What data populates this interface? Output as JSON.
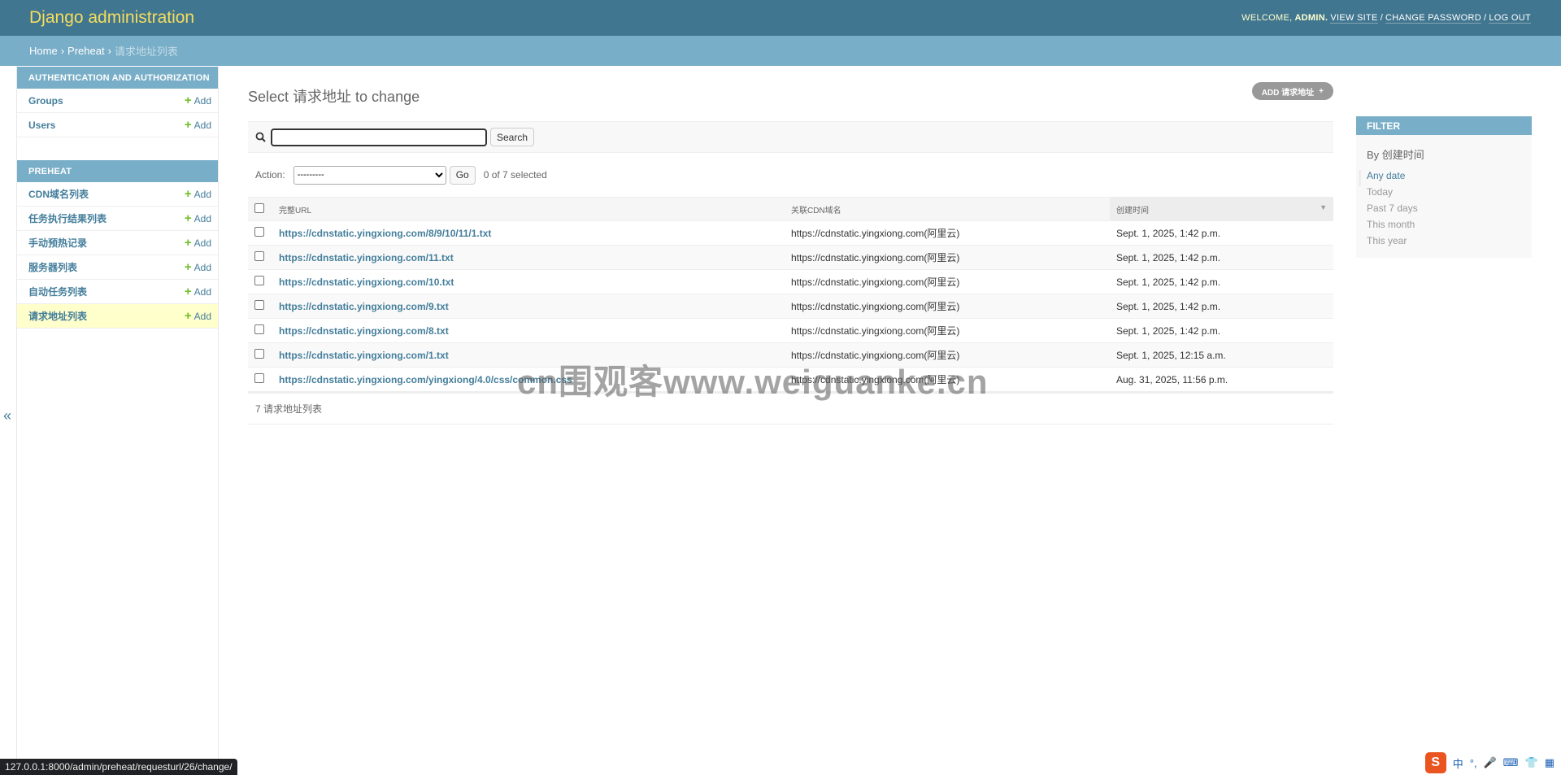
{
  "header": {
    "site_name": "Django administration",
    "welcome": "WELCOME,",
    "username": "ADMIN.",
    "view_site": "VIEW SITE",
    "change_password": "CHANGE PASSWORD",
    "logout": "LOG OUT",
    "sep": "/"
  },
  "breadcrumbs": {
    "home": "Home",
    "app": "Preheat",
    "current": "请求地址列表",
    "sep": "›"
  },
  "sidebar": {
    "toggle": "«",
    "modules": [
      {
        "caption": "AUTHENTICATION AND AUTHORIZATION",
        "items": [
          {
            "label": "Groups",
            "add": "Add"
          },
          {
            "label": "Users",
            "add": "Add"
          }
        ]
      },
      {
        "caption": "PREHEAT",
        "items": [
          {
            "label": "CDN域名列表",
            "add": "Add"
          },
          {
            "label": "任务执行结果列表",
            "add": "Add"
          },
          {
            "label": "手动预热记录",
            "add": "Add"
          },
          {
            "label": "服务器列表",
            "add": "Add"
          },
          {
            "label": "自动任务列表",
            "add": "Add"
          },
          {
            "label": "请求地址列表",
            "add": "Add"
          }
        ]
      }
    ]
  },
  "content": {
    "title": "Select 请求地址 to change",
    "add_button": "ADD 请求地址",
    "search_button": "Search",
    "search_value": "",
    "action_label": "Action:",
    "action_selected": "---------",
    "go_button": "Go",
    "selected_count": "0 of 7 selected",
    "columns": [
      "完整URL",
      "关联CDN域名",
      "创建时间"
    ],
    "rows": [
      {
        "url": "https://cdnstatic.yingxiong.com/8/9/10/11/1.txt",
        "cdn": "https://cdnstatic.yingxiong.com(阿里云)",
        "created": "Sept. 1, 2025, 1:42 p.m."
      },
      {
        "url": "https://cdnstatic.yingxiong.com/11.txt",
        "cdn": "https://cdnstatic.yingxiong.com(阿里云)",
        "created": "Sept. 1, 2025, 1:42 p.m."
      },
      {
        "url": "https://cdnstatic.yingxiong.com/10.txt",
        "cdn": "https://cdnstatic.yingxiong.com(阿里云)",
        "created": "Sept. 1, 2025, 1:42 p.m."
      },
      {
        "url": "https://cdnstatic.yingxiong.com/9.txt",
        "cdn": "https://cdnstatic.yingxiong.com(阿里云)",
        "created": "Sept. 1, 2025, 1:42 p.m."
      },
      {
        "url": "https://cdnstatic.yingxiong.com/8.txt",
        "cdn": "https://cdnstatic.yingxiong.com(阿里云)",
        "created": "Sept. 1, 2025, 1:42 p.m."
      },
      {
        "url": "https://cdnstatic.yingxiong.com/1.txt",
        "cdn": "https://cdnstatic.yingxiong.com(阿里云)",
        "created": "Sept. 1, 2025, 12:15 a.m."
      },
      {
        "url": "https://cdnstatic.yingxiong.com/yingxiong/4.0/css/common.css",
        "cdn": "https://cdnstatic.yingxiong.com(阿里云)",
        "created": "Aug. 31, 2025, 11:56 p.m."
      }
    ],
    "paginator": "7 请求地址列表"
  },
  "filter": {
    "title": "FILTER",
    "by": "By 创建时间",
    "options": [
      "Any date",
      "Today",
      "Past 7 days",
      "This month",
      "This year"
    ]
  },
  "status_url": "127.0.0.1:8000/admin/preheat/requesturl/26/change/",
  "watermark": "cn围观客www.weiguanke.cn",
  "tray": {
    "logo": "S",
    "ime": "中"
  },
  "colors": {
    "header": "#417690",
    "breadcrumbs": "#79aec8",
    "link": "#447e9b",
    "site_name": "#f5dd5d",
    "add_green": "#70bf2b"
  }
}
